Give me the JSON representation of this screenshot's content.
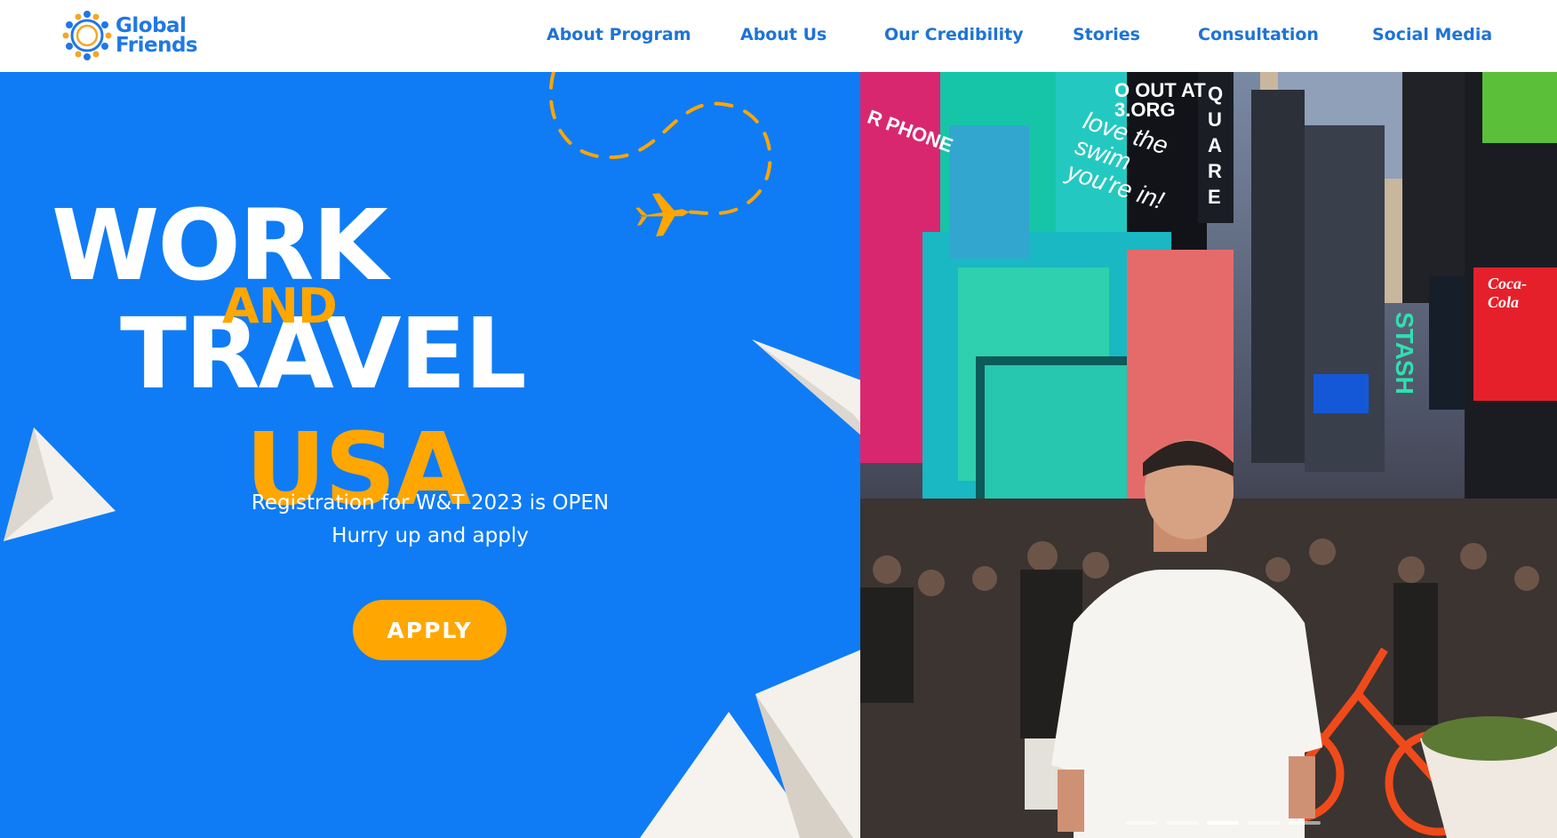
{
  "brand": {
    "line1": "Global",
    "line2": "Friends",
    "color": "#1e78e6"
  },
  "nav": [
    {
      "label": "About Program"
    },
    {
      "label": "About Us"
    },
    {
      "label": "Our Credibility"
    },
    {
      "label": "Stories"
    },
    {
      "label": "Consultation"
    },
    {
      "label": "Social Media"
    }
  ],
  "hero": {
    "title_work": "WORK",
    "title_and": "AND",
    "title_travel": "TRAVEL",
    "title_usa": "USA",
    "registration_line1": "Registration for W&T 2023 is OPEN",
    "registration_line2": "Hurry up and apply",
    "apply_label": "APPLY",
    "bg_color": "#0f7cf5",
    "accent_color": "#ffa600"
  },
  "photo": {
    "billboard_phone": "R PHONE",
    "billboard_org": "O OUT AT\n3.ORG",
    "billboard_square": "QUARE",
    "billboard_swim": "love the\nswim\nyou're in!",
    "billboard_stash": "STASH",
    "billboard_coke": "Coca-Cola"
  },
  "slider": {
    "count": 5,
    "active_index": 2
  }
}
